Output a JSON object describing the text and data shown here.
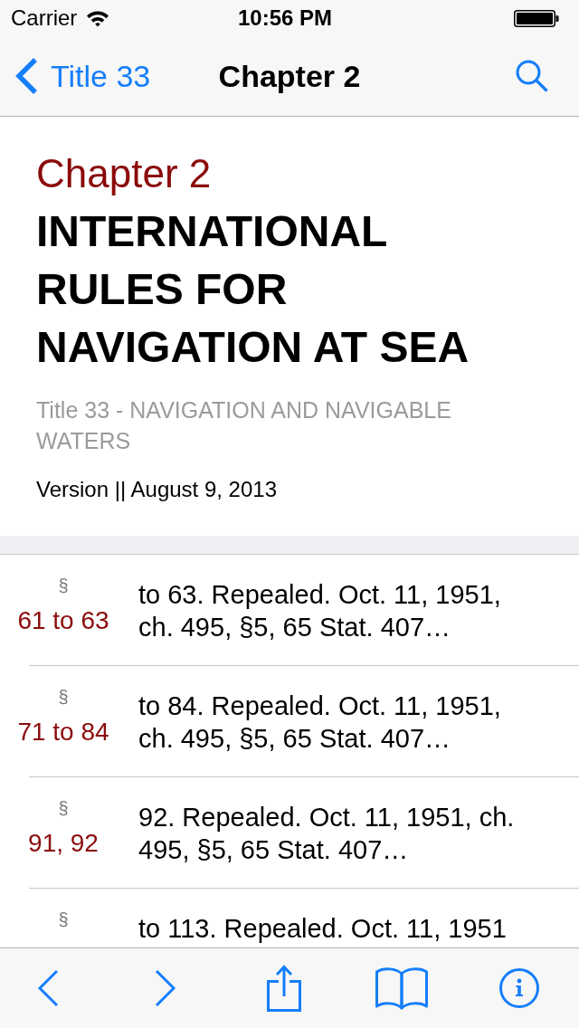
{
  "status_bar": {
    "carrier": "Carrier",
    "time": "10:56 PM"
  },
  "nav_bar": {
    "back_label": "Title 33",
    "title": "Chapter 2"
  },
  "header": {
    "chapter": "Chapter 2",
    "heading": "INTERNATIONAL RULES FOR NAVIGATION AT SEA",
    "title_line": "Title 33 - NAVIGATION AND NAVIGABLE WATERS",
    "version": "Version || August 9, 2013"
  },
  "sections": [
    {
      "mark": "§",
      "number": "61 to 63",
      "summary": "to 63. Repealed. Oct. 11, 1951, ch. 495, §5, 65 Stat. 407…"
    },
    {
      "mark": "§",
      "number": "71 to 84",
      "summary": "to 84. Repealed. Oct. 11, 1951, ch. 495, §5, 65 Stat. 407…"
    },
    {
      "mark": "§",
      "number": "91, 92",
      "summary": "92. Repealed. Oct. 11, 1951, ch. 495, §5, 65 Stat. 407…"
    },
    {
      "mark": "§",
      "summary": "to 113. Repealed. Oct. 11, 1951"
    }
  ]
}
